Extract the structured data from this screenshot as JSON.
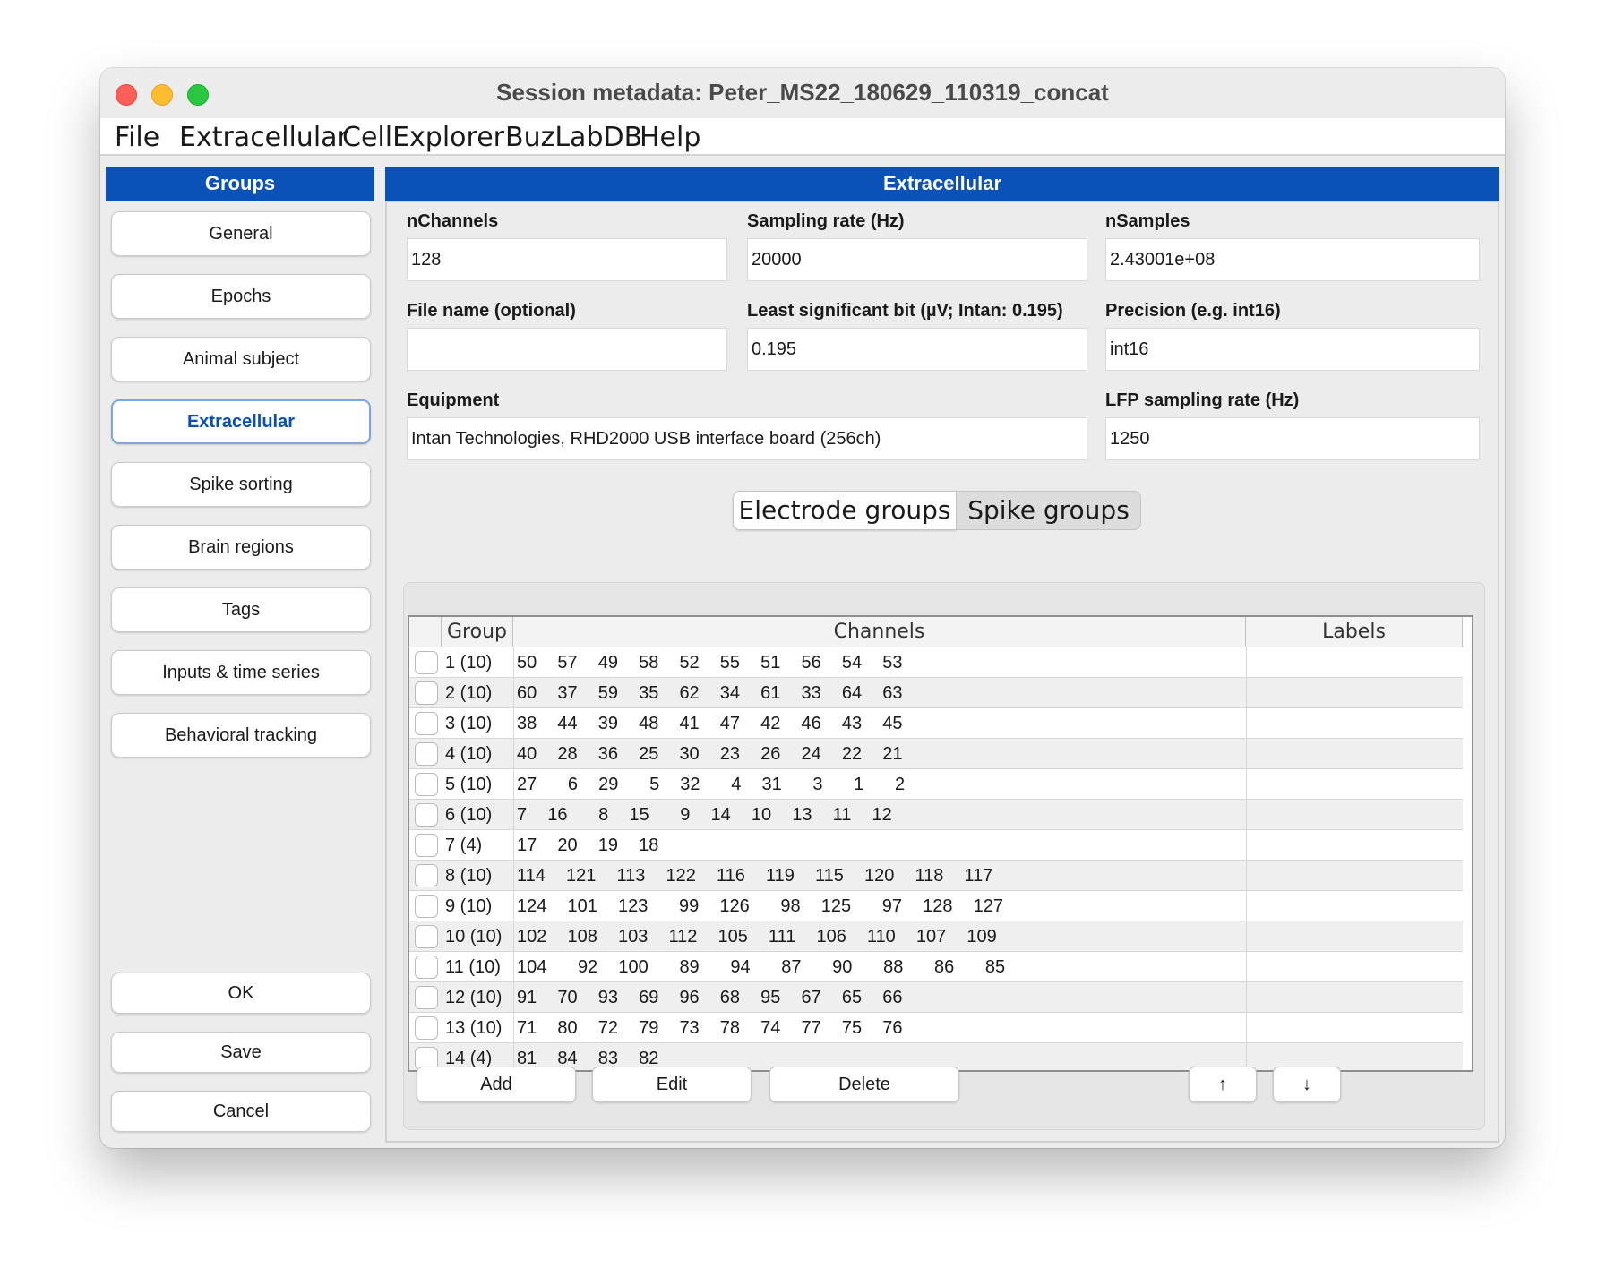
{
  "window": {
    "title": "Session metadata: Peter_MS22_180629_110319_concat"
  },
  "menu": [
    "File",
    "Extracellular",
    "CellExplorer",
    "BuzLabDB",
    "Help"
  ],
  "sidebar": {
    "header": "Groups",
    "items": [
      "General",
      "Epochs",
      "Animal subject",
      "Extracellular",
      "Spike sorting",
      "Brain regions",
      "Tags",
      "Inputs & time series",
      "Behavioral tracking"
    ],
    "active": "Extracellular",
    "actions": [
      "OK",
      "Save",
      "Cancel"
    ]
  },
  "main": {
    "header": "Extracellular",
    "fields": {
      "nchannels": {
        "label": "nChannels",
        "value": "128"
      },
      "sampling_rate": {
        "label": "Sampling rate (Hz)",
        "value": "20000"
      },
      "nsamples": {
        "label": "nSamples",
        "value": "2.43001e+08"
      },
      "file_name": {
        "label": "File name (optional)",
        "value": ""
      },
      "lsb": {
        "label": "Least significant bit (µV; Intan: 0.195)",
        "value": "0.195"
      },
      "precision": {
        "label": "Precision (e.g. int16)",
        "value": "int16"
      },
      "equipment": {
        "label": "Equipment",
        "value": "Intan Technologies, RHD2000 USB interface board (256ch)"
      },
      "lfp_rate": {
        "label": "LFP sampling rate (Hz)",
        "value": "1250"
      }
    },
    "tabs": [
      "Electrode groups",
      "Spike groups"
    ],
    "active_tab": "Electrode groups",
    "table": {
      "columns": [
        "Group",
        "Channels",
        "Labels"
      ],
      "rows": [
        {
          "group": "1 (10)",
          "channels": "50  57  49  58  52  55  51  56  54  53",
          "labels": ""
        },
        {
          "group": "2 (10)",
          "channels": "60  37  59  35  62  34  61  33  64  63",
          "labels": ""
        },
        {
          "group": "3 (10)",
          "channels": "38  44  39  48  41  47  42  46  43  45",
          "labels": ""
        },
        {
          "group": "4 (10)",
          "channels": "40  28  36  25  30  23  26  24  22  21",
          "labels": ""
        },
        {
          "group": "5 (10)",
          "channels": "27   6  29   5  32   4  31   3   1   2",
          "labels": ""
        },
        {
          "group": "6 (10)",
          "channels": "7  16   8  15   9  14  10  13  11  12",
          "labels": ""
        },
        {
          "group": "7 (4)",
          "channels": "17  20  19  18",
          "labels": ""
        },
        {
          "group": "8 (10)",
          "channels": "114  121  113  122  116  119  115  120  118  117",
          "labels": ""
        },
        {
          "group": "9 (10)",
          "channels": "124  101  123   99  126   98  125   97  128  127",
          "labels": ""
        },
        {
          "group": "10 (10)",
          "channels": "102  108  103  112  105  111  106  110  107  109",
          "labels": ""
        },
        {
          "group": "11 (10)",
          "channels": "104   92  100   89   94   87   90   88   86   85",
          "labels": ""
        },
        {
          "group": "12 (10)",
          "channels": "91  70  93  69  96  68  95  67  65  66",
          "labels": ""
        },
        {
          "group": "13 (10)",
          "channels": "71  80  72  79  73  78  74  77  75  76",
          "labels": ""
        },
        {
          "group": "14 (4)",
          "channels": "81  84  83  82",
          "labels": ""
        }
      ]
    },
    "table_buttons": {
      "add": "Add",
      "edit": "Edit",
      "delete": "Delete",
      "up": "↑",
      "down": "↓"
    }
  },
  "colors": {
    "header_blue": "#0a52b8",
    "active_text": "#0a4fb3"
  }
}
